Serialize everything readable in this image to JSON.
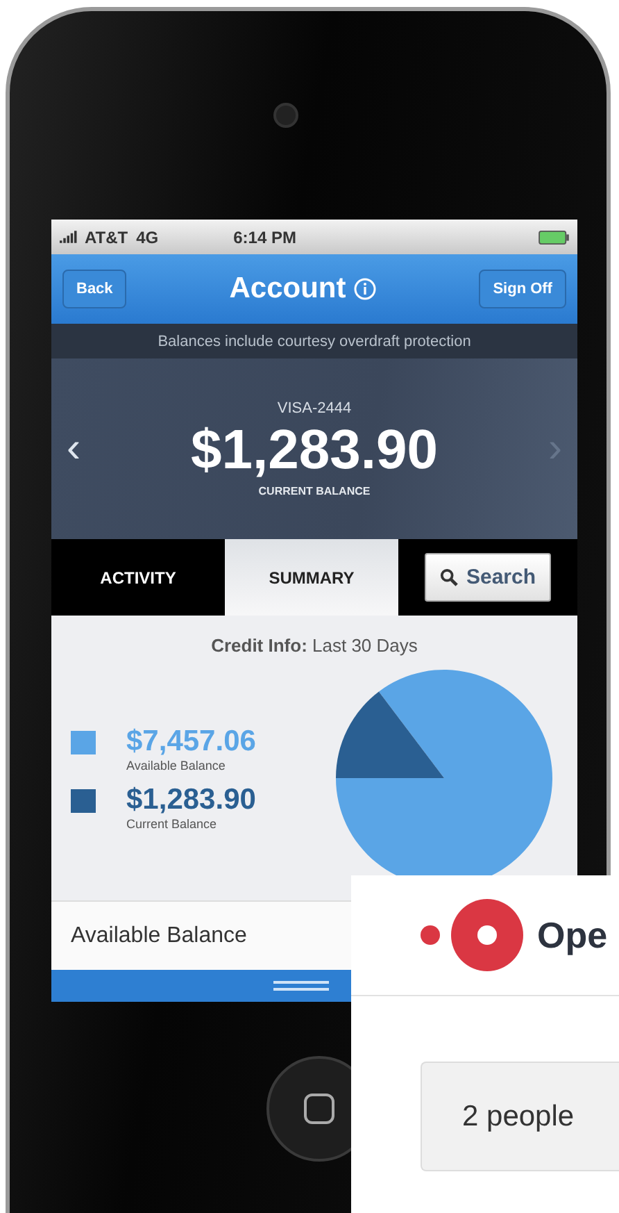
{
  "status_bar": {
    "carrier": "AT&T",
    "network": "4G",
    "time": "6:14 PM"
  },
  "nav_bar": {
    "back": "Back",
    "title": "Account",
    "sign_off": "Sign Off"
  },
  "notice": "Balances include courtesy overdraft protection",
  "account_card": {
    "prev": "‹",
    "account": "VISA-2444",
    "balance": "$1,283.90",
    "caption": "CURRENT BALANCE",
    "next": "›"
  },
  "tabs": [
    {
      "label": "ACTIVITY",
      "selected": false
    },
    {
      "label": "SUMMARY",
      "selected": true
    }
  ],
  "search_button": "Search",
  "summary": {
    "heading": "**Credit Info:** Last 30 Days",
    "legend": [
      {
        "amount": "$7,457.06",
        "label": "Available Balance",
        "color": "#5aa5e6"
      },
      {
        "amount": "$1,283.90",
        "label": "Current Balance",
        "color": "#2a5f92"
      }
    ],
    "chart_data": {
      "type": "pie",
      "values": [
        85.3,
        14.7
      ]
    }
  },
  "list_row": "Available Balance",
  "booking_widget": {
    "brand": "Ope",
    "party_size": "2 people"
  }
}
